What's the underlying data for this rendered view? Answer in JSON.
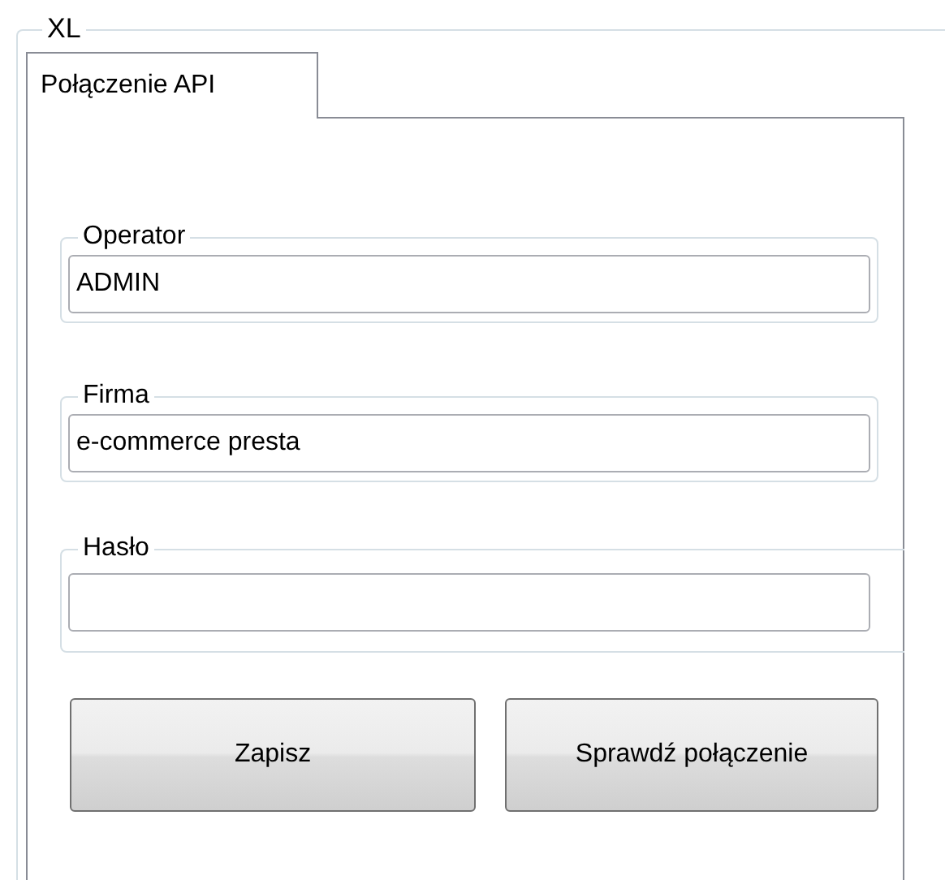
{
  "group": {
    "title": "XL"
  },
  "tabs": [
    {
      "label": "Połączenie API",
      "selected": true
    }
  ],
  "fields": [
    {
      "label": "Operator",
      "value": "ADMIN"
    },
    {
      "label": "Firma",
      "value": "e-commerce presta"
    },
    {
      "label": "Hasło"
    }
  ],
  "buttons": [
    "Zapisz",
    "Sprawdź połączenie"
  ]
}
